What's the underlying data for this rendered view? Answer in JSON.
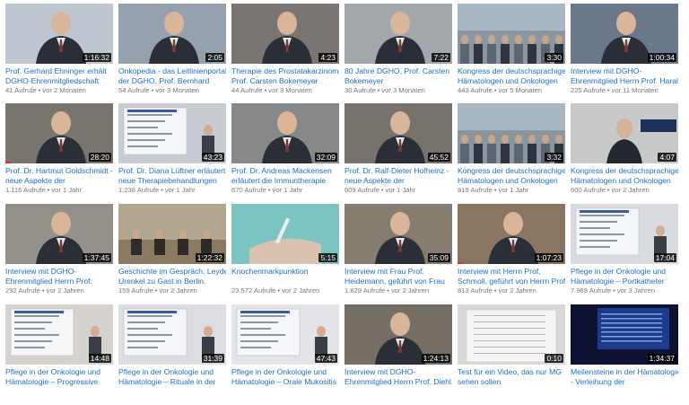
{
  "videos": [
    {
      "title1": "Prof. Gerhard Ehninger erhält",
      "title2": "DGHO-Ehrenmitgliedschaft",
      "views": "41 Aufrufe",
      "age": "vor 2 Monaten",
      "duration": "1:16:32",
      "watched": 0,
      "bg": "#b9c2cc",
      "scene": "person"
    },
    {
      "title1": "Onkopedia - das Leitlinienportal",
      "title2": "der DGHO, Prof. Bernhard",
      "views": "54 Aufrufe",
      "age": "vor 3 Monaten",
      "duration": "2:05",
      "watched": 0,
      "bg": "#8e9aa8",
      "scene": "person"
    },
    {
      "title1": "Therapie des Prostatakarzinoms,",
      "title2": "Prof. Carsten Bokemeyer",
      "views": "44 Aufrufe",
      "age": "vor 3 Monaten",
      "duration": "4:23",
      "watched": 0,
      "bg": "#6f6a68",
      "scene": "person"
    },
    {
      "title1": "80 Jahre DGHO, Prof. Carsten",
      "title2": "Bokemeyer",
      "views": "30 Aufrufe",
      "age": "vor 3 Monaten",
      "duration": "7:22",
      "watched": 0,
      "bg": "#9aa0a4",
      "scene": "person"
    },
    {
      "title1": "Kongress der deutschsprachigen",
      "title2": "Hämatologen und Onkologen",
      "views": "443 Aufrufe",
      "age": "vor 5 Monaten",
      "duration": "3:30",
      "watched": 0,
      "bg": "#8a97a3",
      "scene": "crowd"
    },
    {
      "title1": "Interview mit DGHO-",
      "title2": "Ehrenmitglied Herrn Prof. Harald",
      "views": "225 Aufrufe",
      "age": "vor 11 Monaten",
      "duration": "1:00:34",
      "watched": 0,
      "bg": "#5e6d80",
      "scene": "person"
    },
    {
      "title1": "Prof. Dr. Hartmut Goldschmidt -",
      "title2": "neue Aspekte der",
      "views": "1.116 Aufrufe",
      "age": "vor 1 Jahr",
      "duration": "28:20",
      "watched": 0.05,
      "bg": "#6d6a63",
      "scene": "person"
    },
    {
      "title1": "Prof. Dr. Diana Lüftner erläutert",
      "title2": "neue Therapiebehandlungen",
      "views": "1.238 Aufrufe",
      "age": "vor 1 Jahr",
      "duration": "43:23",
      "watched": 0,
      "bg": "#c8ccd2",
      "scene": "slide"
    },
    {
      "title1": "Prof. Dr. Andreas Mackensen",
      "title2": "erläutert die Immuntherapie",
      "views": "670 Aufrufe",
      "age": "vor 1 Jahr",
      "duration": "32:09",
      "watched": 0,
      "bg": "#7d7e80",
      "scene": "person"
    },
    {
      "title1": "Prof. Dr. Ralf-Dieter Hofheinz -",
      "title2": "neue Aspekte der",
      "views": "609 Aufrufe",
      "age": "vor 1 Jahr",
      "duration": "45:52",
      "watched": 0,
      "bg": "#6c6760",
      "scene": "person"
    },
    {
      "title1": "Kongress der deutschsprachigen",
      "title2": "Hämatologen und Onkologen",
      "views": "819 Aufrufe",
      "age": "vor 1 Jahr",
      "duration": "3:32",
      "watched": 0,
      "bg": "#8a969e",
      "scene": "crowd"
    },
    {
      "title1": "Kongress der deutschsprachigen",
      "title2": "Hämatologen und Onkologen",
      "views": "600 Aufrufe",
      "age": "vor 2 Jahren",
      "duration": "4:07",
      "watched": 0,
      "bg": "#b3b6b8",
      "scene": "leipzig"
    },
    {
      "title1": "Interview mit DGHO-",
      "title2": "Ehrenmitglied Herrn Prof.",
      "views": "292 Aufrufe",
      "age": "vor 2 Jahren",
      "duration": "1:37:45",
      "watched": 0,
      "bg": "#8a8780",
      "scene": "person"
    },
    {
      "title1": "Geschichte im Gespräch. Leyden-",
      "title2": "Urenkel zu Gast in Berlin.",
      "views": "159 Aufrufe",
      "age": "vor 2 Jahren",
      "duration": "1:22:32",
      "watched": 0,
      "bg": "#b1a790",
      "scene": "room"
    },
    {
      "title1": "Knochenmarkpunktion",
      "title2": "",
      "views": "23.572 Aufrufe",
      "age": "vor 2 Jahren",
      "duration": "5:15",
      "watched": 0,
      "bg": "#6fb6b5",
      "scene": "medical"
    },
    {
      "title1": "Interview mit Frau Prof.",
      "title2": "Heidemann, geführt von Frau",
      "views": "1.829 Aufrufe",
      "age": "vor 2 Jahren",
      "duration": "35:09",
      "watched": 0,
      "bg": "#7c7265",
      "scene": "person"
    },
    {
      "title1": "Interview mit Herrn Prof.",
      "title2": "Schmoll, geführt von Herrn Prof.",
      "views": "813 Aufrufe",
      "age": "vor 2 Jahren",
      "duration": "1:07:23",
      "watched": 0.05,
      "bg": "#7f6a55",
      "scene": "person"
    },
    {
      "title1": "Pflege in der Onkologie und",
      "title2": "Hämatologie – Portkatheter",
      "views": "7.969 Aufrufe",
      "age": "vor 3 Jahren",
      "duration": "17:04",
      "watched": 0,
      "bg": "#d9dbe0",
      "scene": "slide"
    },
    {
      "title1": "Pflege in der Onkologie und",
      "title2": "Hämatologie – Progressive",
      "views": "",
      "age": "",
      "duration": "14:48",
      "watched": 0,
      "bg": "#d6d3cf",
      "scene": "slide"
    },
    {
      "title1": "Pflege in der Onkologie und",
      "title2": "Hämatologie – Rituale in der",
      "views": "",
      "age": "",
      "duration": "31:39",
      "watched": 0,
      "bg": "#dcdde2",
      "scene": "slide"
    },
    {
      "title1": "Pflege in der Onkologie und",
      "title2": "Hämatologie – Orale Mukositis",
      "views": "",
      "age": "",
      "duration": "47:43",
      "watched": 0,
      "bg": "#e2e4e8",
      "scene": "slide"
    },
    {
      "title1": "Interview mit DGHO-",
      "title2": "Ehrenmitglied Herrn Prof. Diehl,",
      "views": "",
      "age": "",
      "duration": "1:24:13",
      "watched": 0,
      "bg": "#6a6257",
      "scene": "person"
    },
    {
      "title1": "Test für ein Video, das nur MG",
      "title2": "sehen sollen",
      "views": "",
      "age": "",
      "duration": "0:10",
      "watched": 0,
      "bg": "#d8d8d6",
      "scene": "paper"
    },
    {
      "title1": "Meilensteine in der Hämatologie",
      "title2": "- Verleihung der",
      "views": "",
      "age": "",
      "duration": "1:34:37",
      "watched": 0,
      "bg": "#1e2c6a",
      "scene": "dark"
    }
  ]
}
